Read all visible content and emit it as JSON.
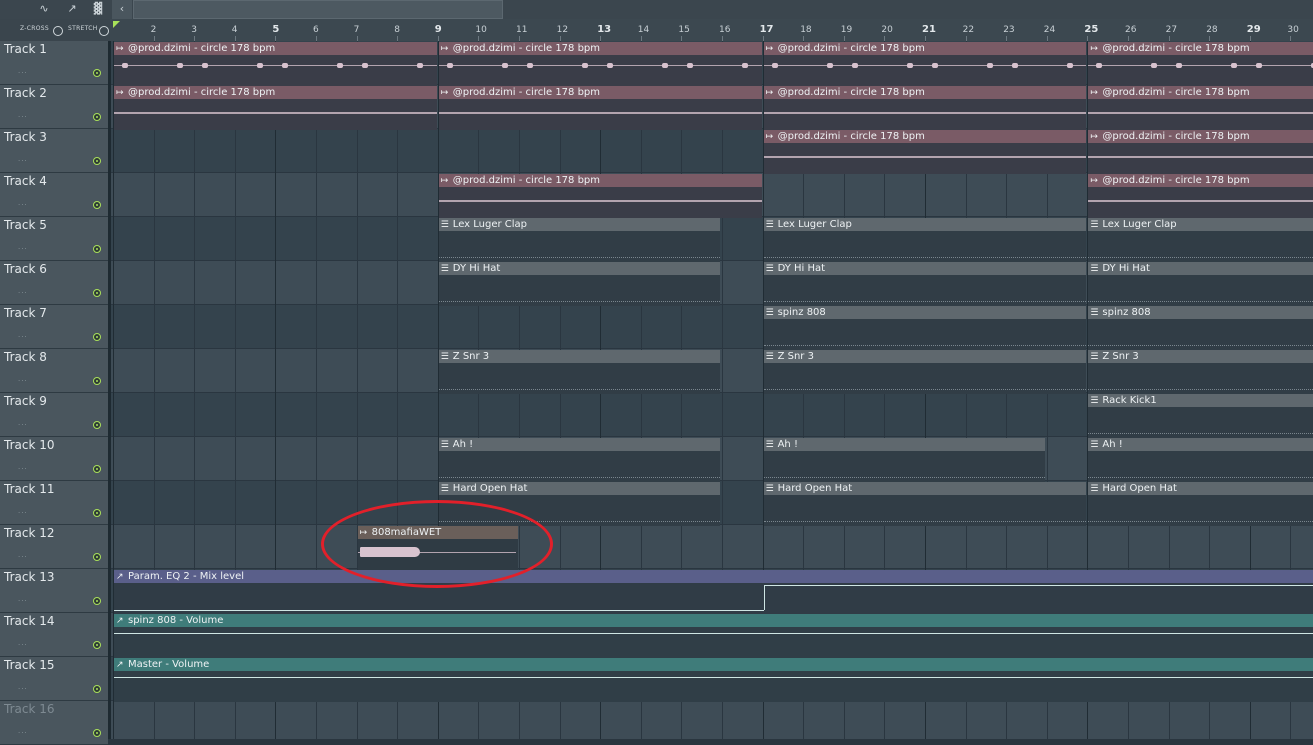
{
  "toolbar": {
    "icons": [
      "waveform-icon",
      "automation-icon",
      "piano-icon",
      "arrow-left-icon"
    ],
    "z_cross_label": "Z-CROSS",
    "stretch_label": "STRETCH"
  },
  "ruler": {
    "bars": [
      "2",
      "3",
      "4",
      "5",
      "6",
      "7",
      "8",
      "9",
      "10",
      "11",
      "12",
      "13",
      "14",
      "15",
      "16",
      "17",
      "18",
      "19",
      "20",
      "21",
      "22",
      "23",
      "24",
      "25",
      "26",
      "27",
      "28",
      "29",
      "30"
    ]
  },
  "tracks": [
    {
      "name": "Track 1"
    },
    {
      "name": "Track 2"
    },
    {
      "name": "Track 3"
    },
    {
      "name": "Track 4"
    },
    {
      "name": "Track 5"
    },
    {
      "name": "Track 6"
    },
    {
      "name": "Track 7"
    },
    {
      "name": "Track 8"
    },
    {
      "name": "Track 9"
    },
    {
      "name": "Track 10"
    },
    {
      "name": "Track 11"
    },
    {
      "name": "Track 12"
    },
    {
      "name": "Track 13"
    },
    {
      "name": "Track 14"
    },
    {
      "name": "Track 15"
    },
    {
      "name": "Track 16"
    }
  ],
  "clips": {
    "prod": "@prod.dzimi - circle 178 bpm",
    "clap": "Lex Luger Clap",
    "hihat": "DY Hi Hat",
    "spinz": "spinz 808",
    "snr": "Z Snr 3",
    "kick": "Rack Kick1",
    "ah": "Ah !",
    "openhat": "Hard Open Hat",
    "wet": "808mafiaWET",
    "eq": "Param. EQ 2 - Mix level",
    "spinzvol": "spinz 808 - Volume",
    "mastervol": "Master - Volume"
  },
  "colors": {
    "audio_clip": "#7a5b66",
    "pattern_clip": "#5f686e",
    "automation_purple": "#5a5f8a",
    "automation_teal": "#3f7c7a",
    "highlight_circle": "#e2202a",
    "track_led": "#a9e05a"
  }
}
